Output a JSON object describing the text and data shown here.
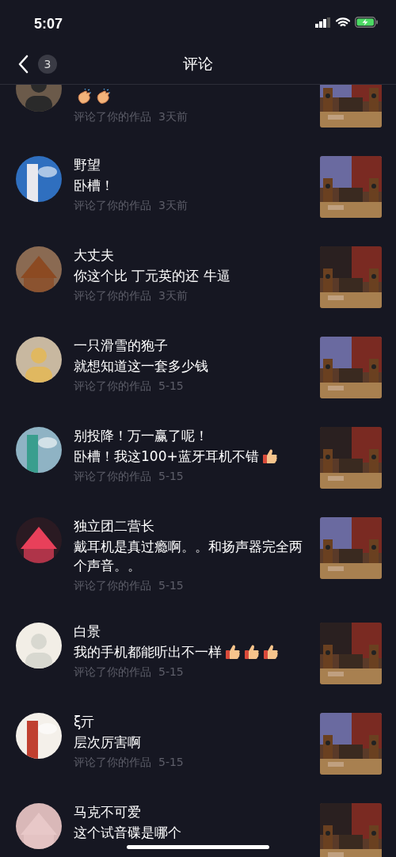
{
  "status_bar": {
    "time": "5:07"
  },
  "nav": {
    "title": "评论",
    "badge": "3"
  },
  "notifications": [
    {
      "emojis": [
        {
          "kind": "clap"
        },
        {
          "kind": "clap"
        }
      ],
      "meta": "评论了你的作品",
      "time": "3天前"
    },
    {
      "name": "野望",
      "comment": "卧槽！",
      "meta": "评论了你的作品",
      "time": "3天前"
    },
    {
      "name": "大丈夫",
      "comment": "你这个比 丁元英的还 牛逼",
      "meta": "评论了你的作品",
      "time": "3天前"
    },
    {
      "name": "一只滑雪的狍子",
      "comment": "就想知道这一套多少钱",
      "meta": "评论了你的作品",
      "time": "5-15"
    },
    {
      "name": "别投降！万一赢了呢！",
      "comment": "卧槽！我这100+蓝牙耳机不错",
      "emojis": [
        {
          "kind": "thumbs_up"
        }
      ],
      "meta": "评论了你的作品",
      "time": "5-15"
    },
    {
      "name": "独立团二营长",
      "comment": "戴耳机是真过瘾啊。。和扬声器完全两个声音。。",
      "meta": "评论了你的作品",
      "time": "5-15"
    },
    {
      "name": "白景",
      "comment": "我的手机都能听出不一样",
      "emojis": [
        {
          "kind": "thumbs_up"
        },
        {
          "kind": "thumbs_up"
        },
        {
          "kind": "thumbs_up"
        }
      ],
      "meta": "评论了你的作品",
      "time": "5-15"
    },
    {
      "name": "ξ亓",
      "comment": "层次厉害啊",
      "meta": "评论了你的作品",
      "time": "5-15"
    },
    {
      "name": "马克不可爱",
      "comment": "这个试音碟是哪个"
    }
  ]
}
